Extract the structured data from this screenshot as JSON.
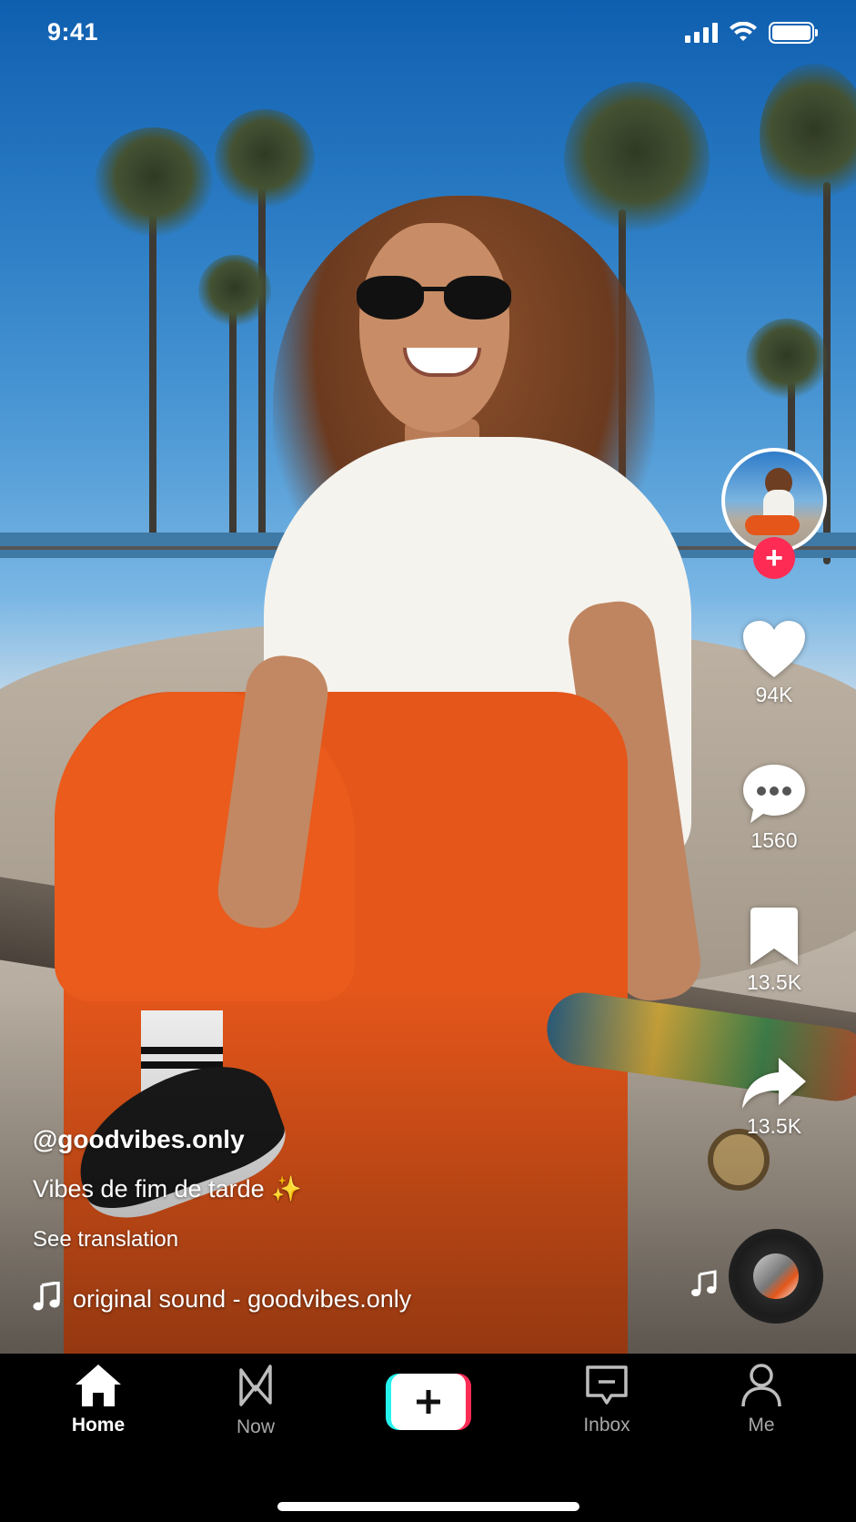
{
  "status_bar": {
    "time": "9:41"
  },
  "video": {
    "username": "@goodvibes.only",
    "description": "Vibes de fim de tarde ✨",
    "see_translation": "See translation",
    "sound": "original sound - goodvibes.only"
  },
  "actions": {
    "likes": "94K",
    "comments": "1560",
    "saves": "13.5K",
    "shares": "13.5K",
    "follow_symbol": "+"
  },
  "nav": {
    "items": [
      {
        "label": "Home",
        "icon": "home-icon",
        "active": true
      },
      {
        "label": "Now",
        "icon": "now-icon",
        "active": false
      },
      {
        "label": "",
        "icon": "plus-icon",
        "active": false
      },
      {
        "label": "Inbox",
        "icon": "inbox-icon",
        "active": false
      },
      {
        "label": "Me",
        "icon": "profile-icon",
        "active": false
      }
    ]
  },
  "colors": {
    "accent_red": "#fe2c55",
    "accent_cyan": "#25f4ee",
    "nav_bg": "#000000"
  }
}
